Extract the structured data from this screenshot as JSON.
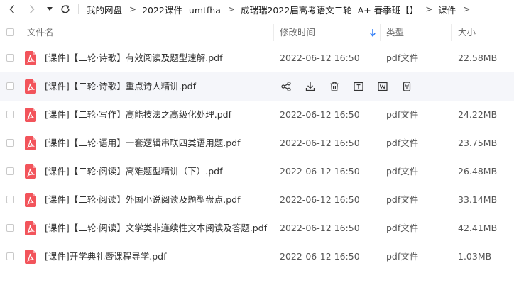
{
  "nav": {
    "back_icon": "chevron-left-icon",
    "forward_icon": "chevron-right-icon",
    "history_icon": "caret-down-icon",
    "refresh_icon": "refresh-icon"
  },
  "breadcrumb": [
    "我的网盘",
    "2022课件--umtfha",
    "成瑞瑞2022届高考语文二轮  A+ 春季班【】",
    "课件"
  ],
  "breadcrumb_sep": ">",
  "columns": {
    "name": "文件名",
    "modified": "修改时间",
    "type": "类型",
    "size": "大小",
    "sort_icon": "arrow-down-icon"
  },
  "files": [
    {
      "name": "[课件]【二轮·诗歌】有效阅读及题型速解.pdf",
      "time": "2022-06-12 16:50",
      "type": "pdf文件",
      "size": "22.58MB"
    },
    {
      "name": "[课件]【二轮·诗歌】重点诗人精讲.pdf",
      "time": "",
      "type": "",
      "size": "",
      "hover": true
    },
    {
      "name": "[课件]【二轮·写作】高能技法之高级化处理.pdf",
      "time": "2022-06-12 16:50",
      "type": "pdf文件",
      "size": "24.22MB"
    },
    {
      "name": "[课件]【二轮·语用】一套逻辑串联四类语用题.pdf",
      "time": "2022-06-12 16:50",
      "type": "pdf文件",
      "size": "23.75MB"
    },
    {
      "name": "[课件]【二轮·阅读】高难题型精讲（下）.pdf",
      "time": "2022-06-12 16:50",
      "type": "pdf文件",
      "size": "26.48MB"
    },
    {
      "name": "[课件]【二轮·阅读】外国小说阅读及题型盘点.pdf",
      "time": "2022-06-12 16:50",
      "type": "pdf文件",
      "size": "33.14MB"
    },
    {
      "name": "[课件]【二轮·阅读】文学类非连续性文本阅读及答题.pdf",
      "time": "2022-06-12 16:50",
      "type": "pdf文件",
      "size": "42.41MB"
    },
    {
      "name": "[课件]开学典礼暨课程导学.pdf",
      "time": "2022-06-12 16:50",
      "type": "pdf文件",
      "size": "1.03MB"
    }
  ],
  "row_actions": [
    "share-icon",
    "download-icon",
    "delete-icon",
    "rename-icon",
    "word-convert-icon",
    "more-icon"
  ],
  "colors": {
    "pdf_icon": "#f2545b",
    "hover_row": "#f5f6fa",
    "sort_arrow": "#2f7cf6",
    "header_text": "#6b6b6b"
  }
}
